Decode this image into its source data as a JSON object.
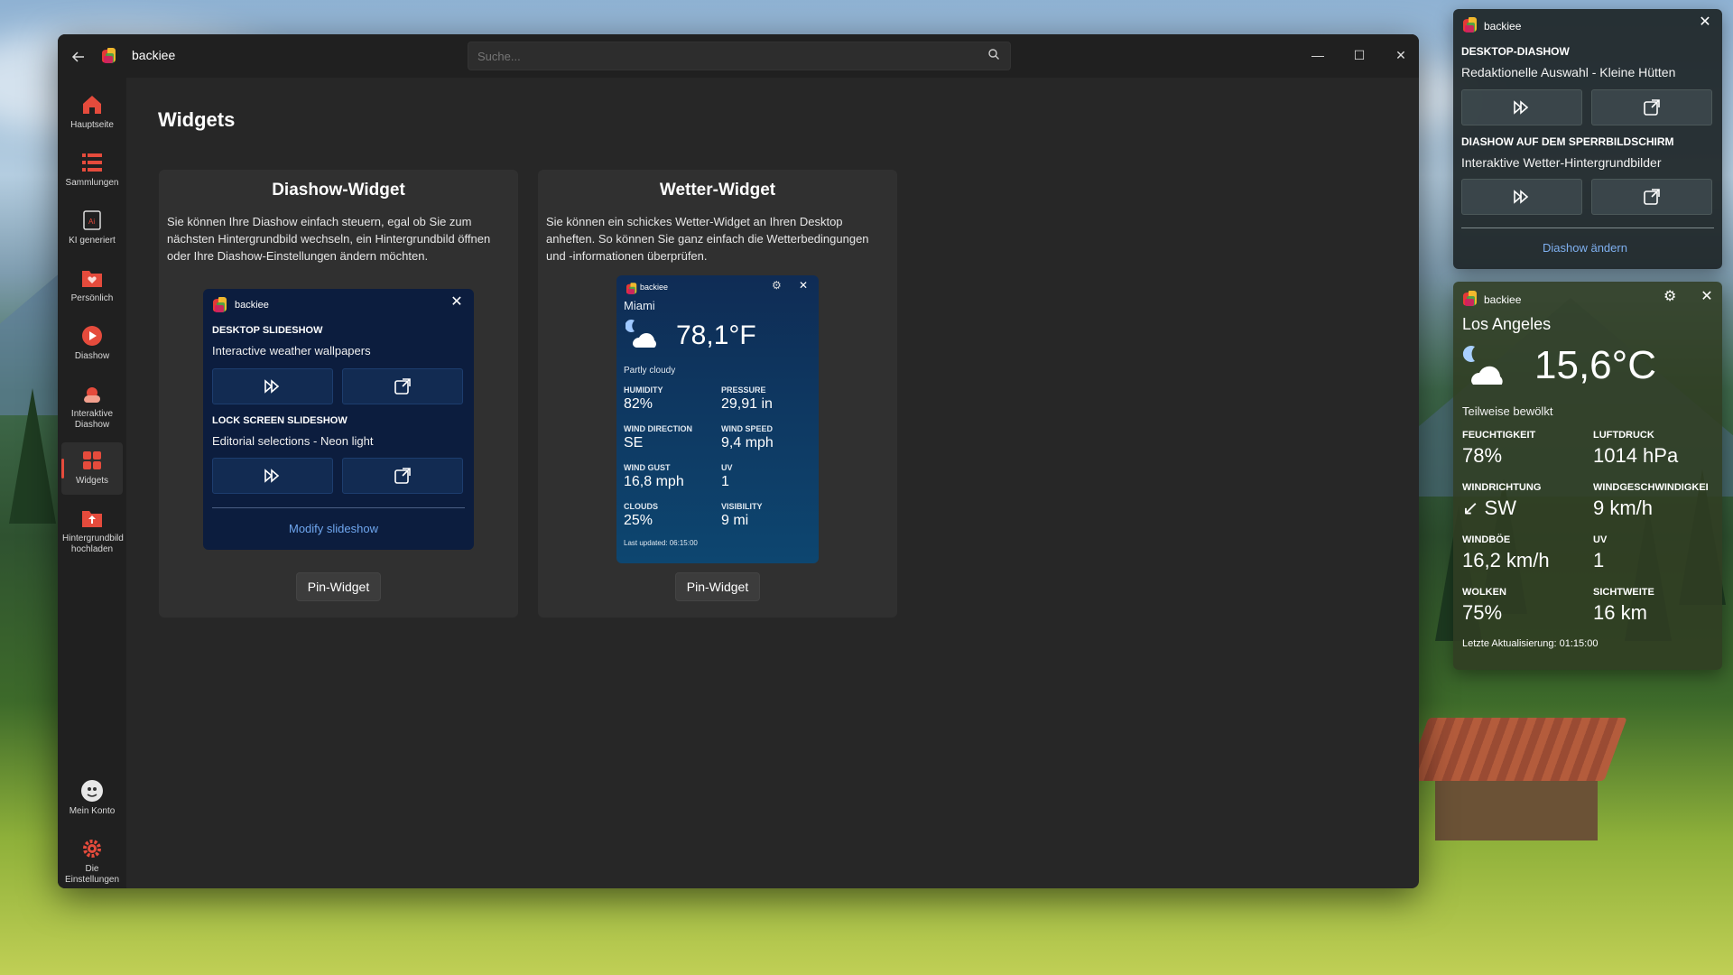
{
  "window": {
    "app_name": "backiee",
    "search_placeholder": "Suche...",
    "page_title": "Widgets"
  },
  "sidebar": {
    "items": [
      {
        "label": "Hauptseite",
        "icon": "home-icon",
        "color": "#e54b3c"
      },
      {
        "label": "Sammlungen",
        "icon": "list-icon",
        "color": "#e54b3c"
      },
      {
        "label": "KI generiert",
        "icon": "ai-icon",
        "color": "#e54b3c"
      },
      {
        "label": "Persönlich",
        "icon": "folder-heart-icon",
        "color": "#e54b3c"
      },
      {
        "label": "Diashow",
        "icon": "play-icon",
        "color": "#e54b3c"
      },
      {
        "label": "Interaktive Diashow",
        "icon": "weather-icon",
        "color": "#e54b3c"
      },
      {
        "label": "Widgets",
        "icon": "widgets-icon",
        "color": "#e54b3c",
        "active": true
      },
      {
        "label": "Hintergrundbild hochladen",
        "icon": "upload-icon",
        "color": "#e54b3c"
      }
    ],
    "bottom": [
      {
        "label": "Mein Konto",
        "icon": "avatar-icon"
      },
      {
        "label": "Die Einstellungen",
        "icon": "gear-icon"
      }
    ]
  },
  "cards": {
    "slideshow": {
      "title": "Diashow-Widget",
      "description": "Sie können Ihre Diashow einfach steuern, egal ob Sie zum nächsten Hintergrundbild wechseln, ein Hintergrundbild öffnen oder Ihre Diashow-Einstellungen ändern möchten.",
      "pin_label": "Pin-Widget",
      "preview": {
        "app_name": "backiee",
        "desktop_heading": "DESKTOP SLIDESHOW",
        "desktop_sub": "Interactive weather wallpapers",
        "lock_heading": "LOCK SCREEN SLIDESHOW",
        "lock_sub": "Editorial selections - Neon light",
        "modify_label": "Modify slideshow"
      }
    },
    "weather": {
      "title": "Wetter-Widget",
      "description": "Sie können ein schickes Wetter-Widget an Ihren Desktop anheften. So können Sie ganz einfach die Wetterbedingungen und -informationen überprüfen.",
      "pin_label": "Pin-Widget",
      "preview": {
        "app_name": "backiee",
        "city": "Miami",
        "temp": "78,1°F",
        "condition": "Partly cloudy",
        "stats": [
          {
            "label": "HUMIDITY",
            "value": "82%"
          },
          {
            "label": "PRESSURE",
            "value": "29,91 in"
          },
          {
            "label": "WIND DIRECTION",
            "value": "SE"
          },
          {
            "label": "WIND SPEED",
            "value": "9,4 mph"
          },
          {
            "label": "WIND GUST",
            "value": "16,8 mph"
          },
          {
            "label": "UV",
            "value": "1"
          },
          {
            "label": "CLOUDS",
            "value": "25%"
          },
          {
            "label": "VISIBILITY",
            "value": "9 mi"
          }
        ],
        "updated": "Last updated: 06:15:00"
      }
    }
  },
  "desktop_slideshow_widget": {
    "app_name": "backiee",
    "desktop_heading": "DESKTOP-DIASHOW",
    "desktop_sub": "Redaktionelle Auswahl - Kleine Hütten",
    "lock_heading": "DIASHOW AUF DEM SPERRBILDSCHIRM",
    "lock_sub": "Interaktive Wetter-Hintergrundbilder",
    "change_label": "Diashow ändern"
  },
  "desktop_weather_widget": {
    "app_name": "backiee",
    "city": "Los Angeles",
    "temp": "15,6°C",
    "condition": "Teilweise bewölkt",
    "stats": [
      {
        "label": "FEUCHTIGKEIT",
        "value": "78%"
      },
      {
        "label": "LUFTDRUCK",
        "value": "1014 hPa"
      },
      {
        "label": "WINDRICHTUNG",
        "value": "↙ SW"
      },
      {
        "label": "WINDGESCHWINDIGKEI",
        "value": "9 km/h"
      },
      {
        "label": "WINDBÖE",
        "value": "16,2 km/h"
      },
      {
        "label": "UV",
        "value": "1"
      },
      {
        "label": "WOLKEN",
        "value": "75%"
      },
      {
        "label": "SICHTWEITE",
        "value": "16 km"
      }
    ],
    "updated": "Letzte Aktualisierung: 01:15:00"
  }
}
